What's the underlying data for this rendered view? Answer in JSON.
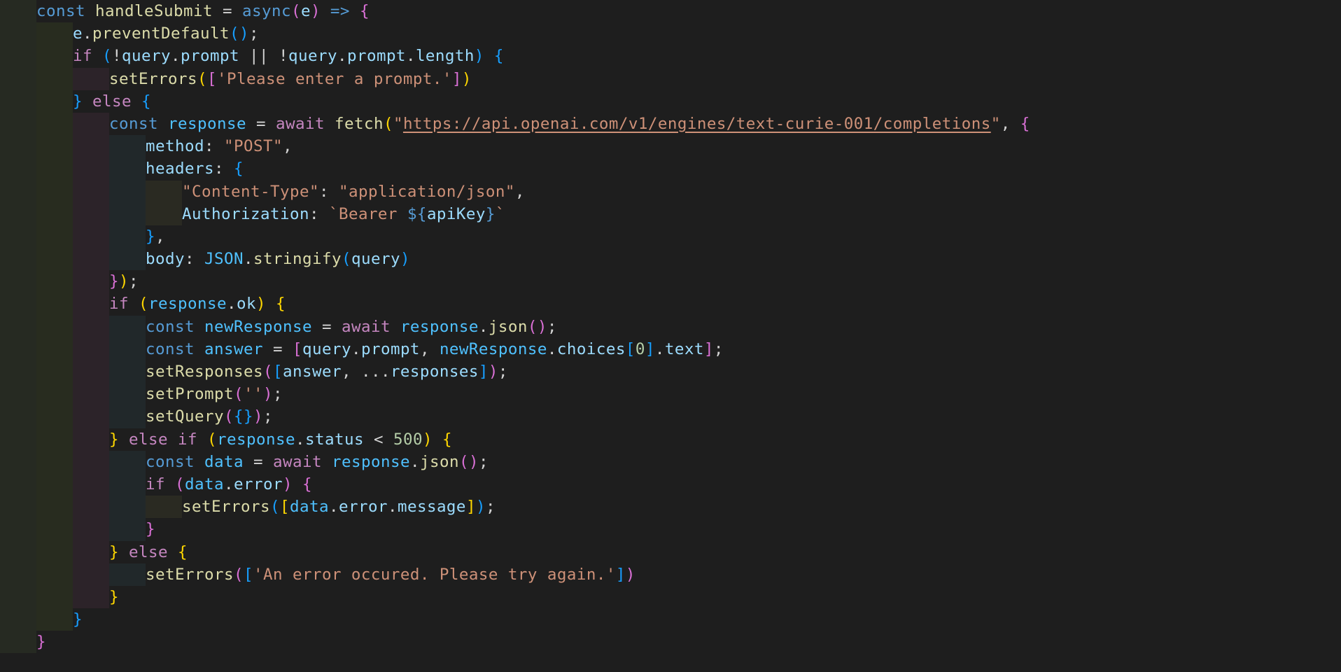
{
  "editor": {
    "theme_colors": {
      "background": "#1e1e1e",
      "keyword": "#569cd6",
      "control": "#c586c0",
      "function": "#dcdcaa",
      "variable": "#9cdcfe",
      "constant": "#4fc1ff",
      "string": "#ce9178",
      "number": "#b5cea8",
      "bracket_level_1": "#ffd700",
      "bracket_level_2": "#da70d6",
      "bracket_level_3": "#179fff"
    },
    "lines": [
      {
        "indent": 0,
        "tokens": [
          [
            "const",
            "k"
          ],
          [
            " ",
            "p"
          ],
          [
            "handleSubmit",
            "f"
          ],
          [
            " = ",
            "p"
          ],
          [
            "async",
            "k"
          ],
          [
            "(",
            "b2"
          ],
          [
            "e",
            "v"
          ],
          [
            ")",
            "b2"
          ],
          [
            " => ",
            "k"
          ],
          [
            "{",
            "b2"
          ]
        ]
      },
      {
        "indent": 1,
        "tokens": [
          [
            "e",
            "v"
          ],
          [
            ".",
            "p"
          ],
          [
            "preventDefault",
            "f"
          ],
          [
            "()",
            "b3"
          ],
          [
            ";",
            "p"
          ]
        ]
      },
      {
        "indent": 1,
        "tokens": [
          [
            "if",
            "c"
          ],
          [
            " ",
            "p"
          ],
          [
            "(",
            "b3"
          ],
          [
            "!",
            "p"
          ],
          [
            "query",
            "v"
          ],
          [
            ".",
            "p"
          ],
          [
            "prompt",
            "v"
          ],
          [
            " || ",
            "p"
          ],
          [
            "!",
            "p"
          ],
          [
            "query",
            "v"
          ],
          [
            ".",
            "p"
          ],
          [
            "prompt",
            "v"
          ],
          [
            ".",
            "p"
          ],
          [
            "length",
            "v"
          ],
          [
            ")",
            "b3"
          ],
          [
            " ",
            "p"
          ],
          [
            "{",
            "b3"
          ]
        ]
      },
      {
        "indent": 2,
        "tokens": [
          [
            "setErrors",
            "f"
          ],
          [
            "(",
            "b1"
          ],
          [
            "[",
            "b2"
          ],
          [
            "'Please enter a prompt.'",
            "s"
          ],
          [
            "]",
            "b2"
          ],
          [
            ")",
            "b1"
          ]
        ]
      },
      {
        "indent": 1,
        "tokens": [
          [
            "}",
            "b3"
          ],
          [
            " ",
            "p"
          ],
          [
            "else",
            "c"
          ],
          [
            " ",
            "p"
          ],
          [
            "{",
            "b3"
          ]
        ]
      },
      {
        "indent": 2,
        "tokens": [
          [
            "const",
            "k"
          ],
          [
            " ",
            "p"
          ],
          [
            "response",
            "cv"
          ],
          [
            " = ",
            "p"
          ],
          [
            "await",
            "c"
          ],
          [
            " ",
            "p"
          ],
          [
            "fetch",
            "f"
          ],
          [
            "(",
            "b1"
          ],
          [
            "\"",
            "s"
          ],
          [
            "https://api.openai.com/v1/engines/text-curie-001/completions",
            "u"
          ],
          [
            "\"",
            "s"
          ],
          [
            ", ",
            "p"
          ],
          [
            "{",
            "b2"
          ]
        ]
      },
      {
        "indent": 3,
        "tokens": [
          [
            "method",
            "v"
          ],
          [
            ": ",
            "p"
          ],
          [
            "\"POST\"",
            "s"
          ],
          [
            ",",
            "p"
          ]
        ]
      },
      {
        "indent": 3,
        "tokens": [
          [
            "headers",
            "v"
          ],
          [
            ": ",
            "p"
          ],
          [
            "{",
            "b3"
          ]
        ]
      },
      {
        "indent": 4,
        "tokens": [
          [
            "\"Content-Type\"",
            "s"
          ],
          [
            ": ",
            "p"
          ],
          [
            "\"application/json\"",
            "s"
          ],
          [
            ",",
            "p"
          ]
        ]
      },
      {
        "indent": 4,
        "tokens": [
          [
            "Authorization",
            "v"
          ],
          [
            ": ",
            "p"
          ],
          [
            "`Bearer ",
            "s"
          ],
          [
            "${",
            "k"
          ],
          [
            "apiKey",
            "v"
          ],
          [
            "}",
            "k"
          ],
          [
            "`",
            "s"
          ]
        ]
      },
      {
        "indent": 3,
        "tokens": [
          [
            "}",
            "b3"
          ],
          [
            ",",
            "p"
          ]
        ]
      },
      {
        "indent": 3,
        "tokens": [
          [
            "body",
            "v"
          ],
          [
            ": ",
            "p"
          ],
          [
            "JSON",
            "cv"
          ],
          [
            ".",
            "p"
          ],
          [
            "stringify",
            "f"
          ],
          [
            "(",
            "b3"
          ],
          [
            "query",
            "v"
          ],
          [
            ")",
            "b3"
          ]
        ]
      },
      {
        "indent": 2,
        "tokens": [
          [
            "}",
            "b2"
          ],
          [
            ")",
            "b1"
          ],
          [
            ";",
            "p"
          ]
        ]
      },
      {
        "indent": 2,
        "tokens": [
          [
            "if",
            "c"
          ],
          [
            " ",
            "p"
          ],
          [
            "(",
            "b1"
          ],
          [
            "response",
            "cv"
          ],
          [
            ".",
            "p"
          ],
          [
            "ok",
            "v"
          ],
          [
            ")",
            "b1"
          ],
          [
            " ",
            "p"
          ],
          [
            "{",
            "b1"
          ]
        ]
      },
      {
        "indent": 3,
        "tokens": [
          [
            "const",
            "k"
          ],
          [
            " ",
            "p"
          ],
          [
            "newResponse",
            "cv"
          ],
          [
            " = ",
            "p"
          ],
          [
            "await",
            "c"
          ],
          [
            " ",
            "p"
          ],
          [
            "response",
            "cv"
          ],
          [
            ".",
            "p"
          ],
          [
            "json",
            "f"
          ],
          [
            "()",
            "b2"
          ],
          [
            ";",
            "p"
          ]
        ]
      },
      {
        "indent": 3,
        "tokens": [
          [
            "const",
            "k"
          ],
          [
            " ",
            "p"
          ],
          [
            "answer",
            "cv"
          ],
          [
            " = ",
            "p"
          ],
          [
            "[",
            "b2"
          ],
          [
            "query",
            "v"
          ],
          [
            ".",
            "p"
          ],
          [
            "prompt",
            "v"
          ],
          [
            ", ",
            "p"
          ],
          [
            "newResponse",
            "cv"
          ],
          [
            ".",
            "p"
          ],
          [
            "choices",
            "v"
          ],
          [
            "[",
            "b3"
          ],
          [
            "0",
            "n"
          ],
          [
            "]",
            "b3"
          ],
          [
            ".",
            "p"
          ],
          [
            "text",
            "v"
          ],
          [
            "]",
            "b2"
          ],
          [
            ";",
            "p"
          ]
        ]
      },
      {
        "indent": 3,
        "tokens": [
          [
            "setResponses",
            "f"
          ],
          [
            "(",
            "b2"
          ],
          [
            "[",
            "b3"
          ],
          [
            "answer",
            "v"
          ],
          [
            ", ...",
            "p"
          ],
          [
            "responses",
            "v"
          ],
          [
            "]",
            "b3"
          ],
          [
            ")",
            "b2"
          ],
          [
            ";",
            "p"
          ]
        ]
      },
      {
        "indent": 3,
        "tokens": [
          [
            "setPrompt",
            "f"
          ],
          [
            "(",
            "b2"
          ],
          [
            "''",
            "s"
          ],
          [
            ")",
            "b2"
          ],
          [
            ";",
            "p"
          ]
        ]
      },
      {
        "indent": 3,
        "tokens": [
          [
            "setQuery",
            "f"
          ],
          [
            "(",
            "b2"
          ],
          [
            "{}",
            "b3"
          ],
          [
            ")",
            "b2"
          ],
          [
            ";",
            "p"
          ]
        ]
      },
      {
        "indent": 2,
        "tokens": [
          [
            "}",
            "b1"
          ],
          [
            " ",
            "p"
          ],
          [
            "else",
            "c"
          ],
          [
            " ",
            "p"
          ],
          [
            "if",
            "c"
          ],
          [
            " ",
            "p"
          ],
          [
            "(",
            "b1"
          ],
          [
            "response",
            "cv"
          ],
          [
            ".",
            "p"
          ],
          [
            "status",
            "v"
          ],
          [
            " < ",
            "p"
          ],
          [
            "500",
            "n"
          ],
          [
            ")",
            "b1"
          ],
          [
            " ",
            "p"
          ],
          [
            "{",
            "b1"
          ]
        ]
      },
      {
        "indent": 3,
        "tokens": [
          [
            "const",
            "k"
          ],
          [
            " ",
            "p"
          ],
          [
            "data",
            "cv"
          ],
          [
            " = ",
            "p"
          ],
          [
            "await",
            "c"
          ],
          [
            " ",
            "p"
          ],
          [
            "response",
            "cv"
          ],
          [
            ".",
            "p"
          ],
          [
            "json",
            "f"
          ],
          [
            "()",
            "b2"
          ],
          [
            ";",
            "p"
          ]
        ]
      },
      {
        "indent": 3,
        "tokens": [
          [
            "if",
            "c"
          ],
          [
            " ",
            "p"
          ],
          [
            "(",
            "b2"
          ],
          [
            "data",
            "cv"
          ],
          [
            ".",
            "p"
          ],
          [
            "error",
            "v"
          ],
          [
            ")",
            "b2"
          ],
          [
            " ",
            "p"
          ],
          [
            "{",
            "b2"
          ]
        ]
      },
      {
        "indent": 4,
        "tokens": [
          [
            "setErrors",
            "f"
          ],
          [
            "(",
            "b3"
          ],
          [
            "[",
            "b1"
          ],
          [
            "data",
            "cv"
          ],
          [
            ".",
            "p"
          ],
          [
            "error",
            "v"
          ],
          [
            ".",
            "p"
          ],
          [
            "message",
            "v"
          ],
          [
            "]",
            "b1"
          ],
          [
            ")",
            "b3"
          ],
          [
            ";",
            "p"
          ]
        ]
      },
      {
        "indent": 3,
        "tokens": [
          [
            "}",
            "b2"
          ]
        ]
      },
      {
        "indent": 2,
        "tokens": [
          [
            "}",
            "b1"
          ],
          [
            " ",
            "p"
          ],
          [
            "else",
            "c"
          ],
          [
            " ",
            "p"
          ],
          [
            "{",
            "b1"
          ]
        ]
      },
      {
        "indent": 3,
        "tokens": [
          [
            "setErrors",
            "f"
          ],
          [
            "(",
            "b2"
          ],
          [
            "[",
            "b3"
          ],
          [
            "'An error occured. Please try again.'",
            "s"
          ],
          [
            "]",
            "b3"
          ],
          [
            ")",
            "b2"
          ]
        ]
      },
      {
        "indent": 2,
        "tokens": [
          [
            "}",
            "b1"
          ]
        ]
      },
      {
        "indent": 1,
        "tokens": [
          [
            "}",
            "b3"
          ]
        ]
      },
      {
        "indent": 0,
        "tokens": [
          [
            "}",
            "b2"
          ]
        ]
      }
    ]
  }
}
